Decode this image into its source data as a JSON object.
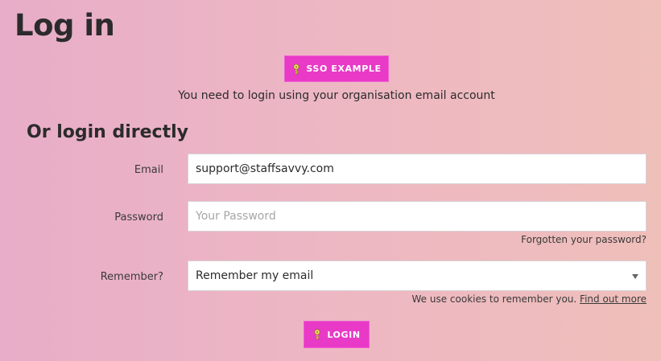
{
  "page": {
    "title": "Log in"
  },
  "sso": {
    "button_label": "SSO EXAMPLE",
    "button_icon": "key-icon",
    "info_text": "You need to login using your organisation email account"
  },
  "direct_login": {
    "section_title": "Or login directly",
    "email": {
      "label": "Email",
      "value": "support@staffsavvy.com"
    },
    "password": {
      "label": "Password",
      "placeholder": "Your Password",
      "forgot_link": "Forgotten your password?"
    },
    "remember": {
      "label": "Remember?",
      "selected": "Remember my email",
      "cookie_notice": "We use cookies to remember you.",
      "find_out_more_link": "Find out more"
    },
    "login_button": {
      "label": "LOGIN",
      "icon": "key-icon"
    }
  },
  "colors": {
    "button_bg": "#e83ac6",
    "key_icon": "#f7e36b",
    "text": "#2b2b2b"
  }
}
